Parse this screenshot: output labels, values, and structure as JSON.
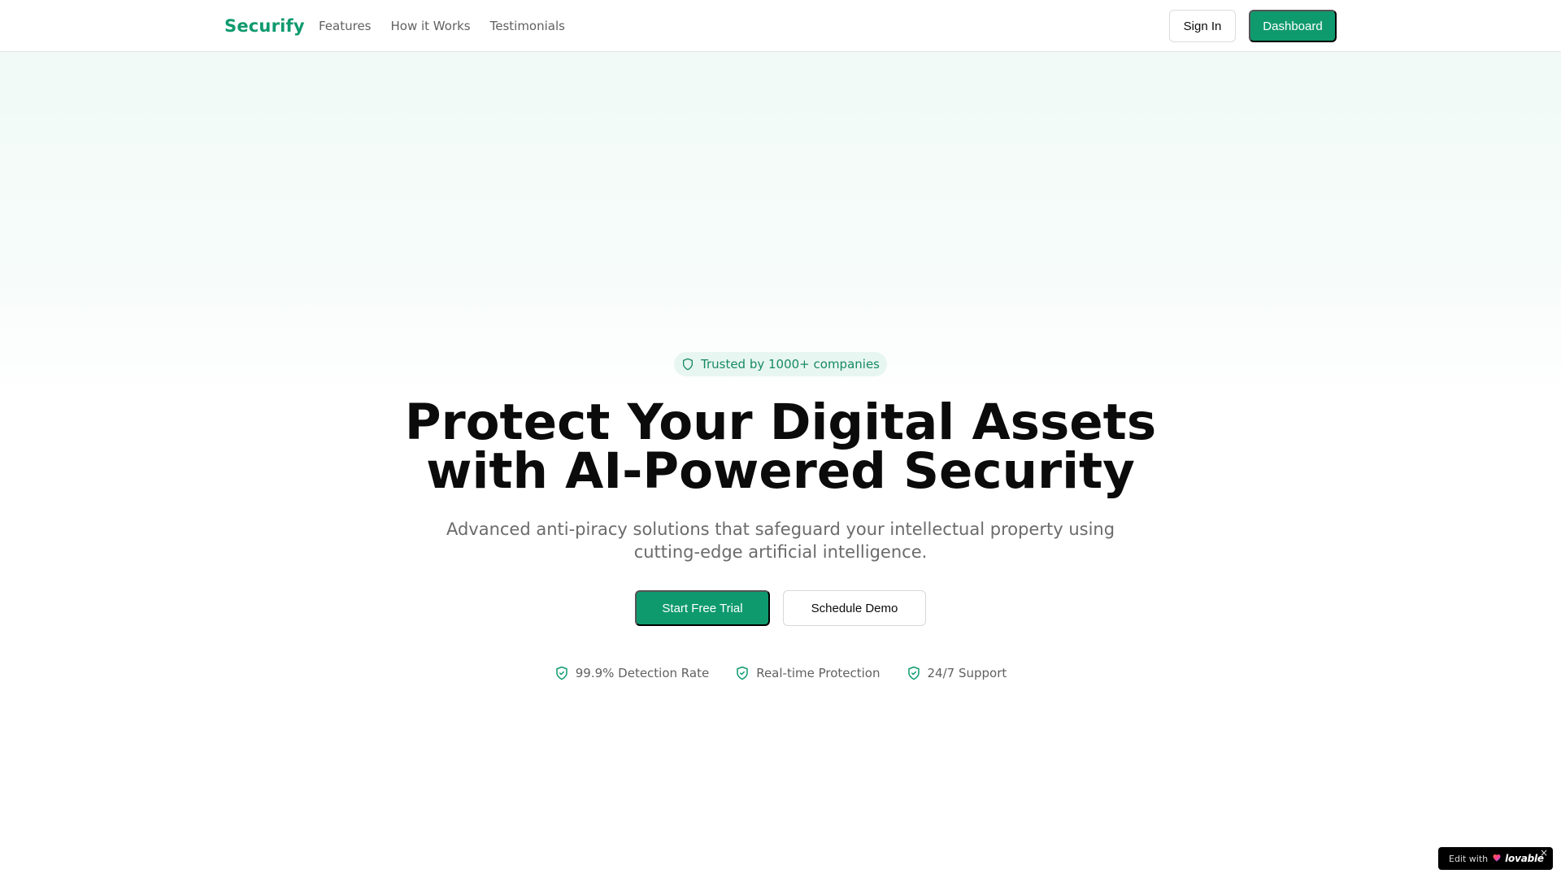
{
  "header": {
    "brand": "Securify",
    "nav": [
      {
        "label": "Features"
      },
      {
        "label": "How it Works"
      },
      {
        "label": "Testimonials"
      }
    ],
    "sign_in_label": "Sign In",
    "dashboard_label": "Dashboard"
  },
  "hero": {
    "badge_text": "Trusted by 1000+ companies",
    "title_line1": "Protect Your Digital Assets",
    "title_line2": "with AI-Powered Security",
    "subtitle": "Advanced anti-piracy solutions that safeguard your intellectual property using cutting-edge artificial intelligence.",
    "primary_cta": "Start Free Trial",
    "secondary_cta": "Schedule Demo",
    "features": [
      {
        "label": "99.9% Detection Rate",
        "icon": "shield-check-icon"
      },
      {
        "label": "Real-time Protection",
        "icon": "shield-check-icon"
      },
      {
        "label": "24/7 Support",
        "icon": "shield-check-icon"
      }
    ]
  },
  "lovable_badge": {
    "prefix": "Edit with",
    "brand": "lovable",
    "close": "×"
  },
  "colors": {
    "brand": "#0f9a6e",
    "badge_bg": "#e8f6f1",
    "text_muted": "#616161"
  }
}
